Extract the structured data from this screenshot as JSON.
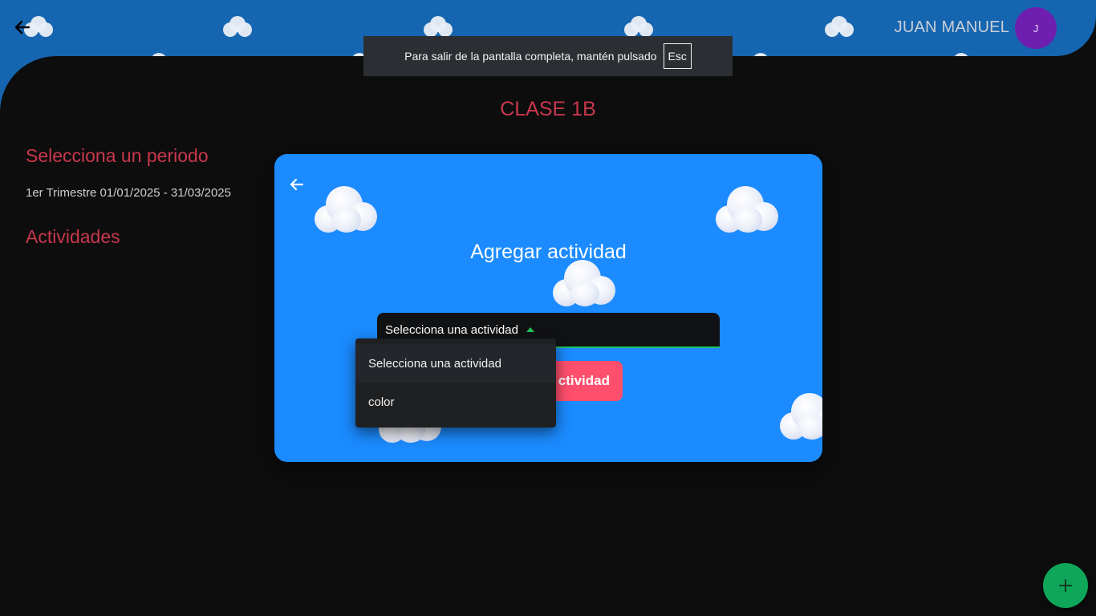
{
  "header": {
    "user_name": "JUAN MANUEL",
    "avatar_initial": "J",
    "back_icon": "arrow-left-icon",
    "background_color": "#1565b0"
  },
  "fullscreen_toast": {
    "message": "Para salir de la pantalla completa, mantén pulsado",
    "key": "Esc"
  },
  "page": {
    "title": "CLASE 1B",
    "period_heading": "Selecciona un periodo",
    "period_value": "1er Trimestre 01/01/2025 - 31/03/2025",
    "activities_heading": "Actividades",
    "accent_color": "#c8384d"
  },
  "modal": {
    "title": "Agregar actividad",
    "select_value": "Selecciona una actividad",
    "add_button_label": "ctividad",
    "background_color": "#1b8bff",
    "button_color": "#ff4f6d"
  },
  "dropdown": {
    "options": [
      "Selecciona una actividad",
      "color"
    ],
    "selected": "Selecciona una actividad"
  },
  "fab": {
    "icon": "plus-icon",
    "color": "#0ea659"
  }
}
